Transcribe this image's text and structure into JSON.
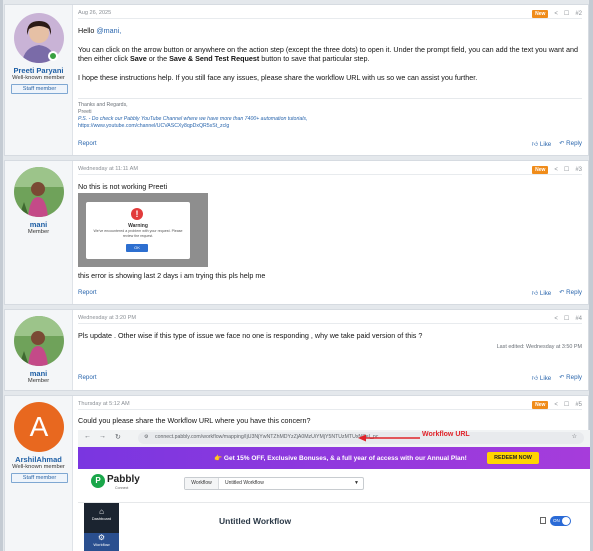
{
  "posts": [
    {
      "user": {
        "name": "Preeti Paryani",
        "title": "Well-known member",
        "badge": "Staff member"
      },
      "date": "Aug 26, 2025",
      "new_label": "New",
      "number": "#2",
      "greeting_prefix": "Hello ",
      "greeting_mention": "@mani,",
      "para1_a": "You can click on the arrow button or anywhere on the action step (except the three dots) to open it. Under the prompt field, you can add the text you want and then either click ",
      "para1_save": "Save",
      "para1_b": " or the ",
      "para1_sst": "Save & Send Test Request",
      "para1_c": " button to save that particular step.",
      "para2": "I hope these instructions help. If you still face any issues, please share the workflow URL with us so we can assist you further.",
      "signature": {
        "line1": "Thanks and Regards,",
        "line2": "Preeti",
        "line3": "P.S. - Do check our Pabbly YouTube Channel where we have more than 7400+ automation tutorials,",
        "line4": "https://www.youtube.com/channel/UCVASCXy8qpDxQR5sSt_zclg"
      },
      "report": "Report",
      "like": "Like",
      "reply": "Reply"
    },
    {
      "user": {
        "name": "mani",
        "title": "Member"
      },
      "date": "Wednesday at 11:11 AM",
      "new_label": "New",
      "number": "#3",
      "text1": "No this is not working Preeti",
      "warning": {
        "title": "Warning",
        "message": "We've encountered a problem with your request. Please review the request.",
        "ok": "OK"
      },
      "text2": "this error is showing last 2 days i am trying this pls help me",
      "report": "Report",
      "like": "Like",
      "reply": "Reply"
    },
    {
      "user": {
        "name": "mani",
        "title": "Member"
      },
      "date": "Wednesday at 3:20 PM",
      "number": "#4",
      "text1": "Pls update . Other wise if this type of issue we face no one is responding , why we take paid version of this ?",
      "edited": "Last edited: Wednesday at 3:50 PM",
      "report": "Report",
      "like": "Like",
      "reply": "Reply"
    },
    {
      "user": {
        "name": "ArshilAhmad",
        "title": "Well-known member",
        "badge": "Staff member",
        "initial": "A"
      },
      "date": "Thursday at 5:12 AM",
      "new_label": "New",
      "number": "#5",
      "text1": "Could you please share the Workflow URL where you have this concern?",
      "browser": {
        "url": "connect.pabbly.com/workflow/mapping/IjU3NjYwNTZhMDYzZjA0MzUiYMjY5NTUzMTUxNSeI_pc",
        "url_label": "Workflow URL",
        "promo": "👉 Get 15% OFF, Exclusive Bonuses, & a full year of access with our Annual Plan!",
        "redeem": "REDEEM NOW",
        "brand": "Pabbly",
        "brand_sub": "Connect",
        "workflow_label": "Workflow",
        "workflow_value": "Untitled Workflow",
        "sidebar": [
          {
            "label": "Dashboard"
          },
          {
            "label": "Workflow"
          }
        ],
        "workflow_title": "Untitled Workflow",
        "toggle": "ON"
      }
    }
  ],
  "colors": {
    "accent": "#2a66ad",
    "new_badge": "#f08c1a",
    "promo": "#8a3ee6",
    "redeem": "#ffd400"
  }
}
